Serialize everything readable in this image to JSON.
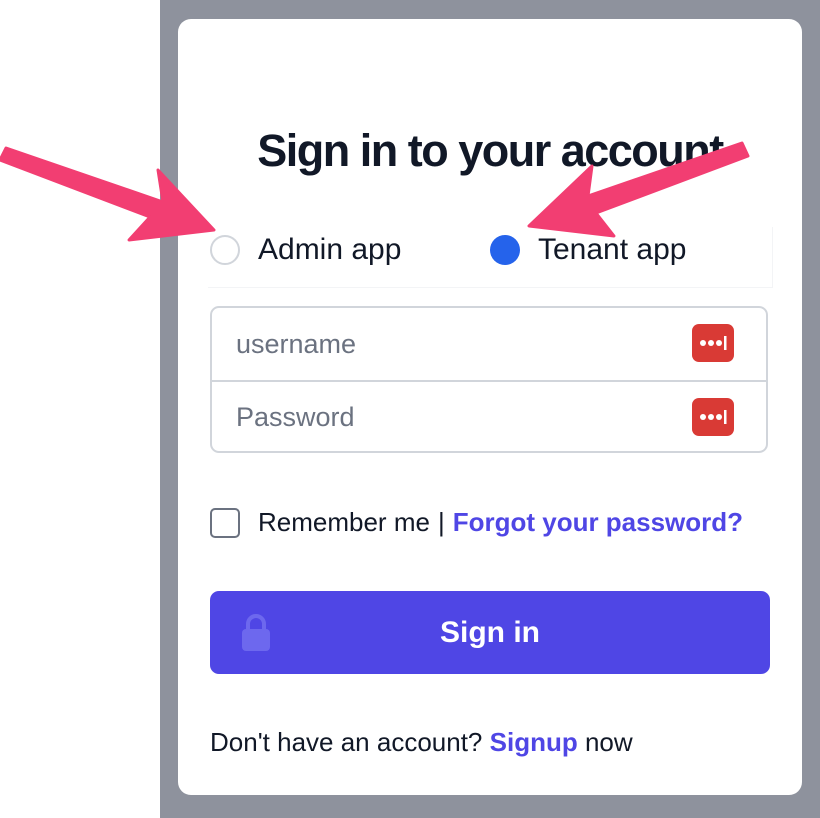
{
  "login": {
    "title": "Sign in to your account",
    "app_options": [
      {
        "label": "Admin app",
        "selected": false
      },
      {
        "label": "Tenant app",
        "selected": true
      }
    ],
    "username": {
      "placeholder": "username",
      "value": ""
    },
    "password": {
      "placeholder": "Password",
      "value": ""
    },
    "remember_label": "Remember me",
    "separator": "|",
    "forgot_link": "Forgot your password?",
    "signin_button": "Sign in",
    "footer": {
      "prefix": "Don't have an account?",
      "signup_link": "Signup",
      "suffix": "now"
    }
  },
  "icons": {
    "password_manager": "password-manager-icon",
    "signin": "lock-icon"
  },
  "colors": {
    "accent": "#4f46e5",
    "radio_selected": "#2563eb",
    "annotation_arrow": "#f23e72",
    "password_manager": "#d93a35",
    "backdrop": "#8e929d"
  }
}
